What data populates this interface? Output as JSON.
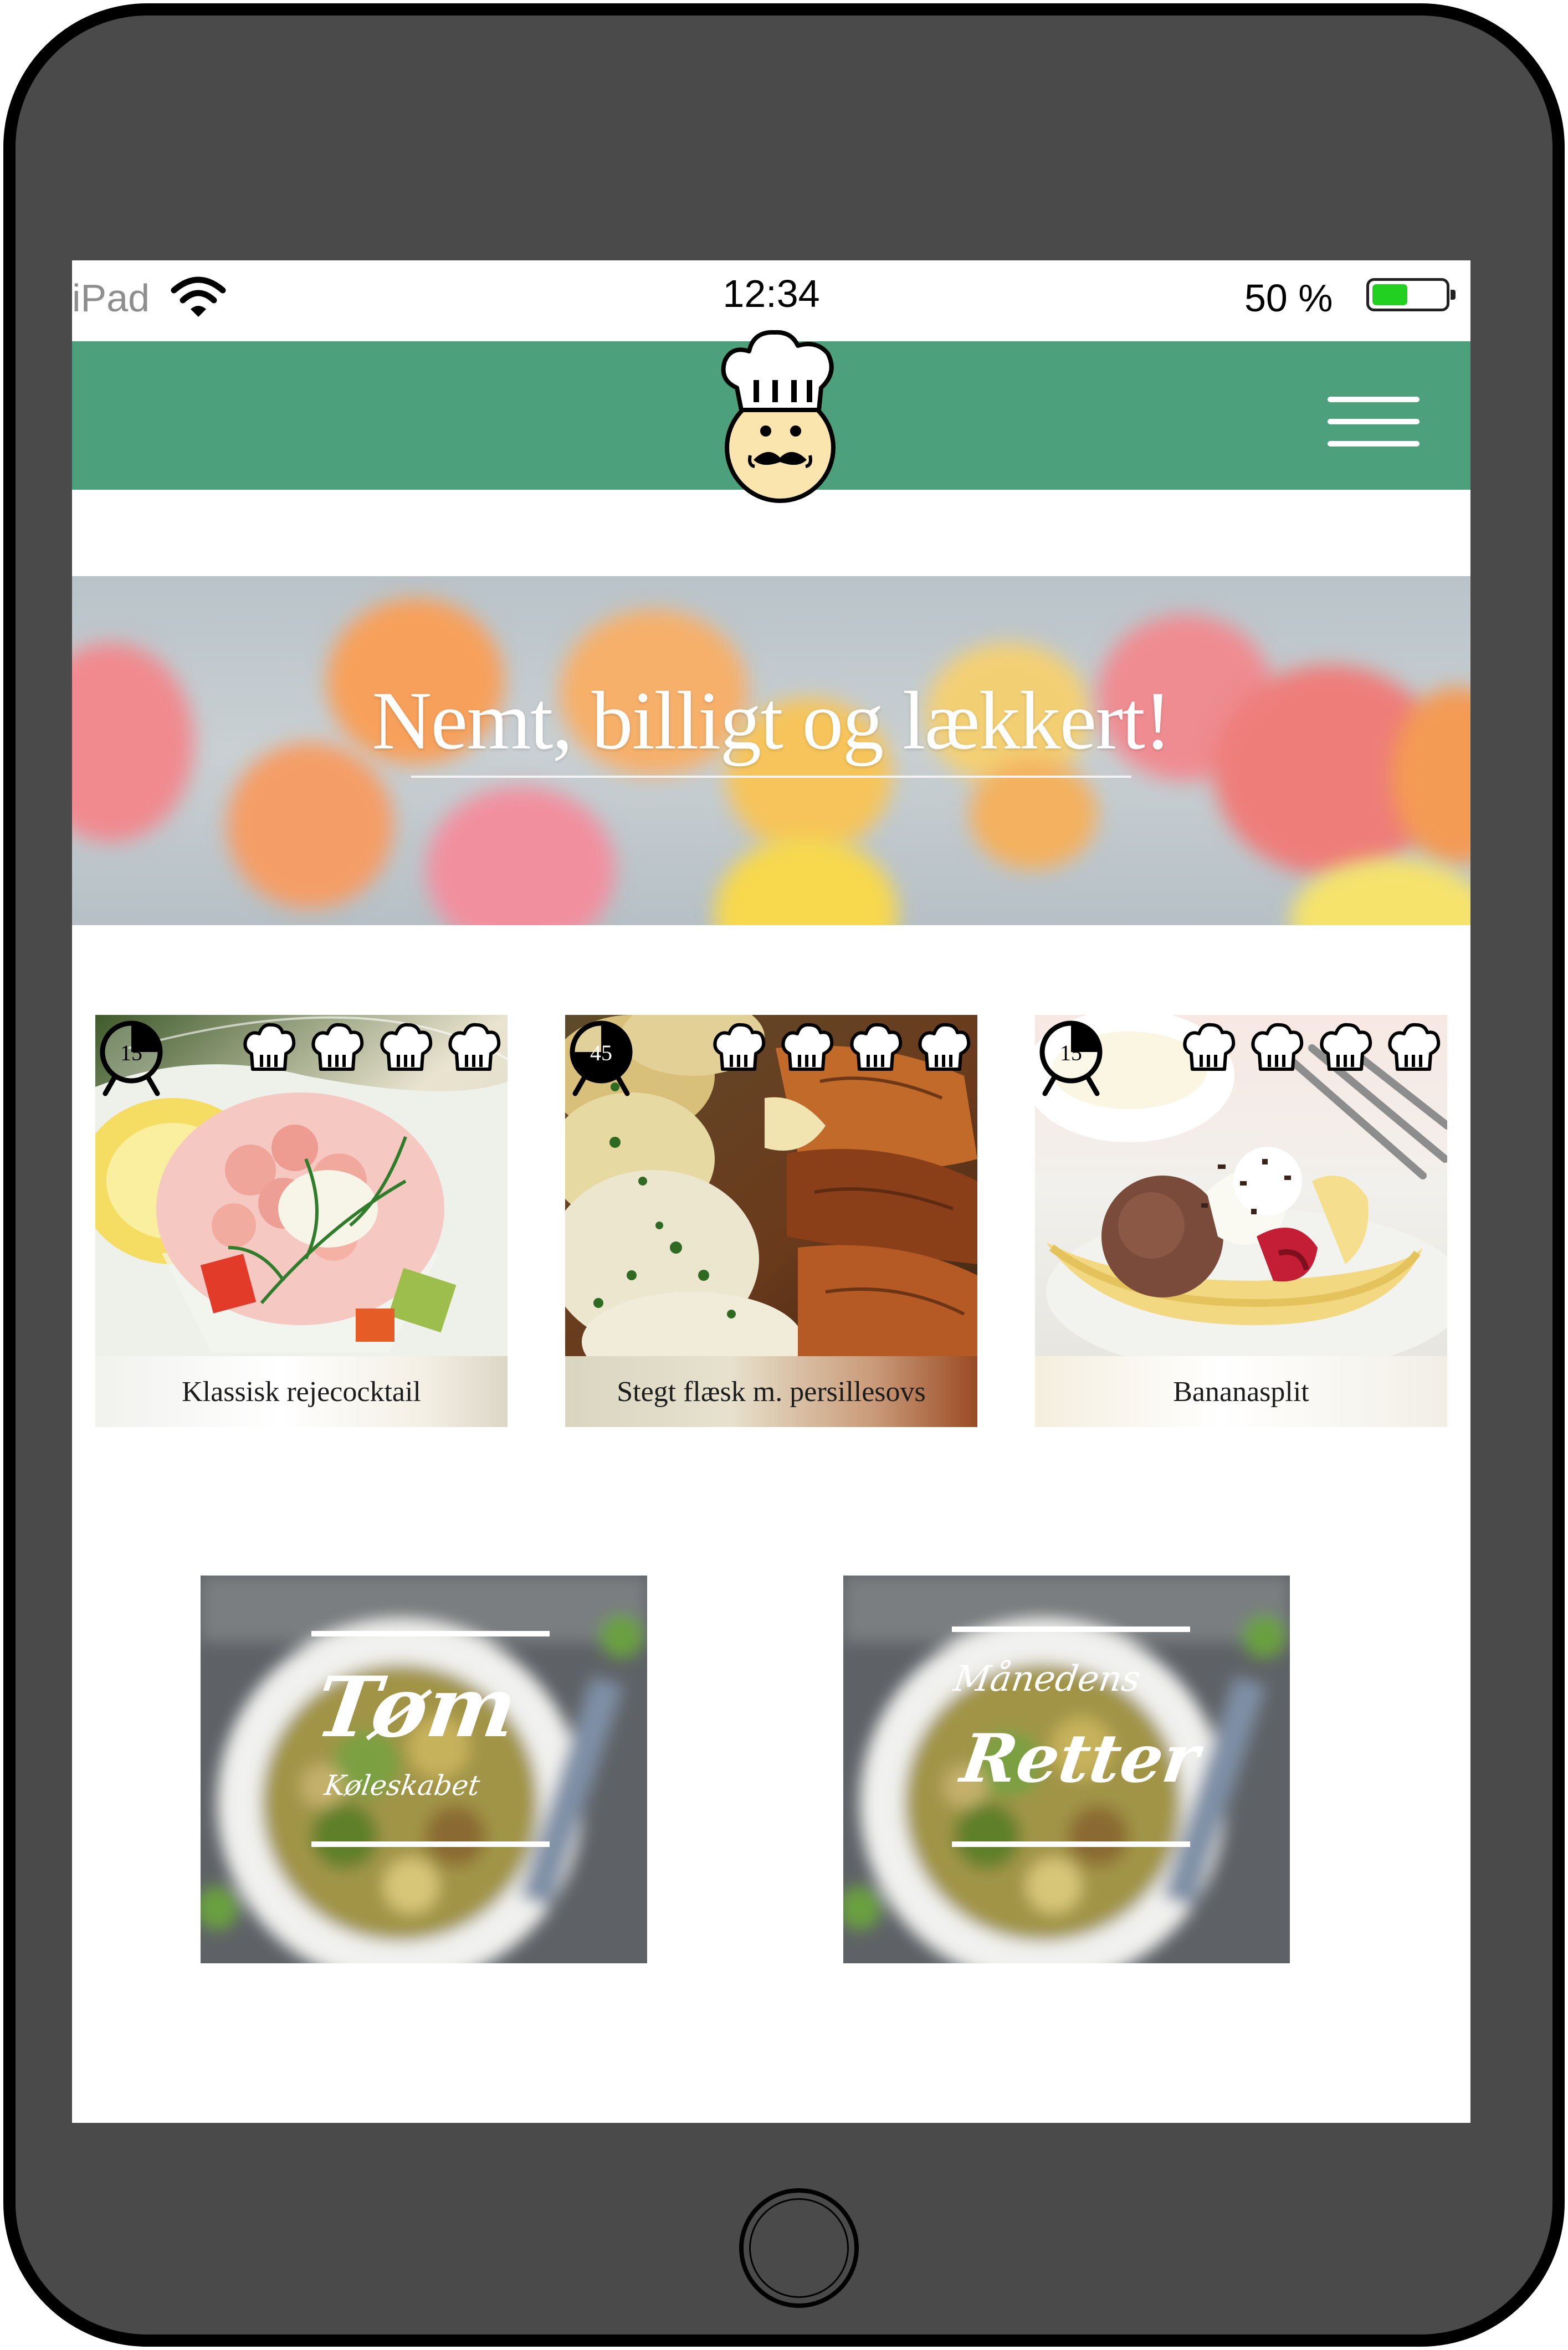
{
  "status_bar": {
    "carrier": "iPad",
    "time": "12:34",
    "battery": "50 %",
    "battery_level": 0.5
  },
  "header": {
    "logo_icon": "chef-logo-icon",
    "menu_icon": "hamburger-menu-icon",
    "color": "#4da07c"
  },
  "hero": {
    "title": "Nemt, billigt og lækkert!"
  },
  "recipes": [
    {
      "title": "Klassisk rejecocktail",
      "time": "15",
      "difficulty_icons": 4
    },
    {
      "title": "Stegt flæsk m. persillesovs",
      "time": "45",
      "difficulty_icons": 4
    },
    {
      "title": "Bananasplit",
      "time": "15",
      "difficulty_icons": 4
    }
  ],
  "promos": [
    {
      "title": "Tøm",
      "subtitle": "Køleskabet"
    },
    {
      "title": "Retter",
      "subtitle": "Månedens"
    }
  ],
  "device": {
    "home_button_icon": "home-button-icon"
  }
}
